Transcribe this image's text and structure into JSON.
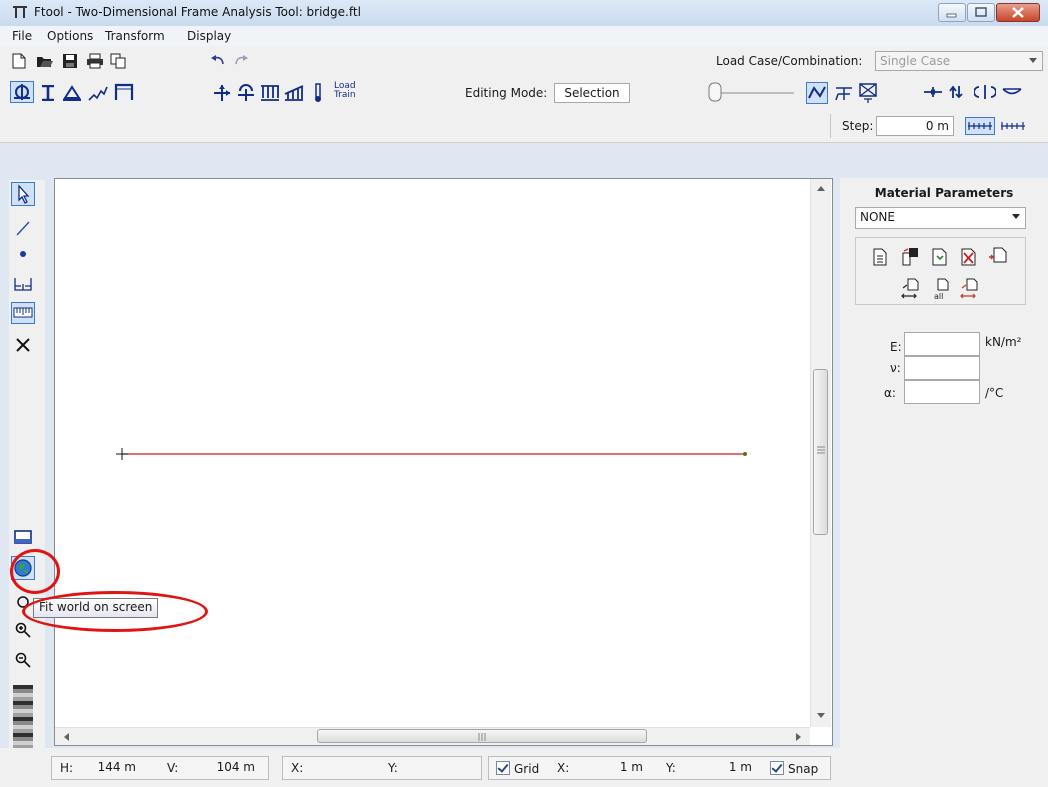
{
  "window": {
    "title": "Ftool - Two-Dimensional Frame Analysis Tool: bridge.ftl"
  },
  "menu": [
    "File",
    "Options",
    "Transform",
    "Display"
  ],
  "toolbar1": {
    "load_case_label": "Load Case/Combination:",
    "load_case_value": "Single Case"
  },
  "toolbar2": {
    "load_train_label_1": "Load",
    "load_train_label_2": "Train",
    "editing_mode_label": "Editing Mode:",
    "editing_mode_value": "Selection"
  },
  "toolbar3": {
    "step_label": "Step:",
    "step_value": "0 m"
  },
  "tooltip": "Fit world on screen",
  "right_panel": {
    "title": "Material Parameters",
    "material_value": "NONE",
    "e_label": "E:",
    "e_unit": "kN/m²",
    "nu_label": "ν:",
    "alpha_label": "α:",
    "alpha_unit": "/°C"
  },
  "status": {
    "h_label": "H:",
    "h_value": "144 m",
    "v_label": "V:",
    "v_value": "104 m",
    "x_label": "X:",
    "y_label": "Y:",
    "grid_label": "Grid",
    "grid_x_label": "X:",
    "grid_x_value": "1 m",
    "grid_y_label": "Y:",
    "grid_y_value": "1 m",
    "snap_label": "Snap"
  },
  "colors": {
    "member": "#d21a1a",
    "annotation": "#e11414"
  },
  "icons": {
    "tools_left": [
      "select-arrow-icon",
      "draw-line-icon",
      "draw-node-icon",
      "dimension-icon",
      "grid-ruler-icon",
      "delete-x-icon"
    ],
    "view_left": [
      "zoom-window-icon",
      "fit-world-icon",
      "zoom-in-icon",
      "zoom-out-icon",
      "color-scale-icon"
    ]
  }
}
